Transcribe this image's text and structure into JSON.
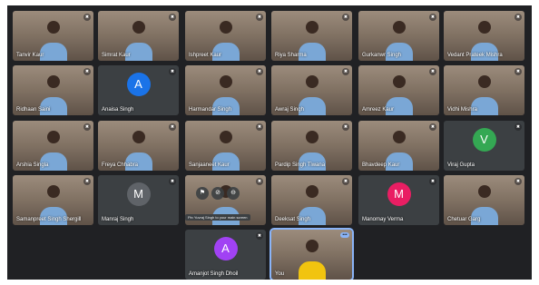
{
  "participants": [
    {
      "name": "Tanvir Kaur",
      "type": "video"
    },
    {
      "name": "Simrat Kaur",
      "type": "video"
    },
    {
      "name": "Ishpreet Kaur",
      "type": "video"
    },
    {
      "name": "Riya Sharma",
      "type": "video"
    },
    {
      "name": "Gurkanwr Singh",
      "type": "video"
    },
    {
      "name": "Vedant Prateek Mishra",
      "type": "video"
    },
    {
      "name": "Ridhaan Saini",
      "type": "video"
    },
    {
      "name": "Anaisa Singh",
      "type": "avatar",
      "initial": "A",
      "color": "#1a73e8"
    },
    {
      "name": "Harmandar Singh",
      "type": "video"
    },
    {
      "name": "Awraj Singh",
      "type": "video"
    },
    {
      "name": "Amreez Kaur",
      "type": "video"
    },
    {
      "name": "Vidhi Mishra",
      "type": "video"
    },
    {
      "name": "Arshia Singla",
      "type": "video"
    },
    {
      "name": "Freya Chhabra",
      "type": "video"
    },
    {
      "name": "Sanjaaneet Kaur",
      "type": "video"
    },
    {
      "name": "Pardip Singh Tiwana",
      "type": "video"
    },
    {
      "name": "Bhavdeep Kaur",
      "type": "video"
    },
    {
      "name": "Viraj Gupta",
      "type": "avatar",
      "initial": "V",
      "color": "#34a853"
    },
    {
      "name": "Samanpreet Singh Shergill",
      "type": "video"
    },
    {
      "name": "Manraj Singh",
      "type": "avatar",
      "initial": "M",
      "color": "#5f6368"
    },
    {
      "name": "",
      "type": "video",
      "has_controls": true,
      "tooltip": "Pin Yuvraj Singh to your main screen"
    },
    {
      "name": "Deeksat Singh",
      "type": "video"
    },
    {
      "name": "Manomay Verma",
      "type": "avatar",
      "initial": "M",
      "color": "#e91e63"
    },
    {
      "name": "Chetuar Garg",
      "type": "video"
    },
    {
      "name": "Amanjot Singh Dhoil",
      "type": "avatar",
      "initial": "A",
      "color": "#a142f4"
    },
    {
      "name": "You",
      "type": "video",
      "is_self": true
    }
  ],
  "icons": {
    "mic_off": "mic-off-icon",
    "pin": "pin-icon",
    "more": "more-options-icon"
  }
}
